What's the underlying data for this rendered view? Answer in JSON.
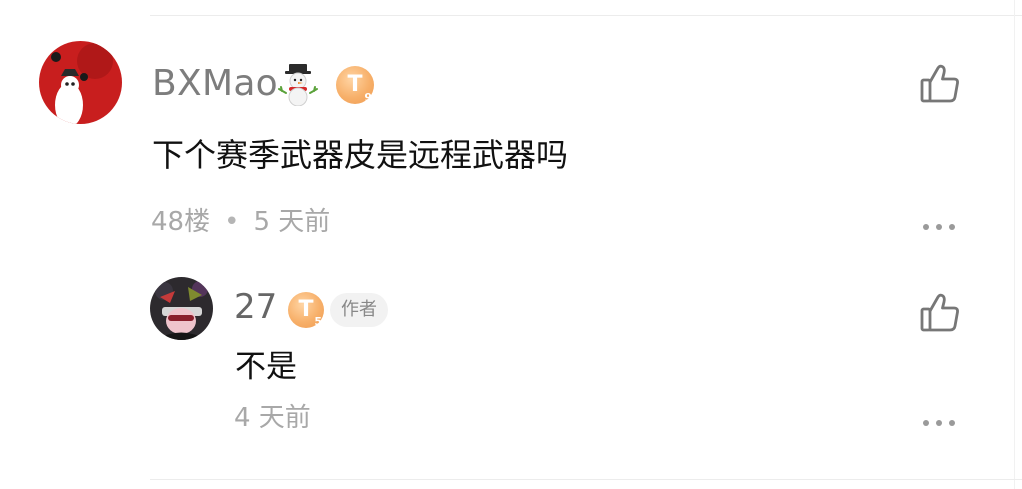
{
  "comments": [
    {
      "username": "BXMao",
      "username_emoji": "snowman-icon",
      "level_badge": {
        "letter": "T",
        "level": "9",
        "color": "#f7b06a"
      },
      "content": "下个赛季武器皮是远程武器吗",
      "floor": "48楼",
      "separator": "•",
      "time": "5 天前"
    },
    {
      "username": "27",
      "level_badge": {
        "letter": "T",
        "level": "5",
        "color": "#f7b06a"
      },
      "author_tag": "作者",
      "content": "不是",
      "time": "4 天前"
    }
  ],
  "colors": {
    "meta_text": "#a8a8a8",
    "username_text": "#7d7d7d",
    "badge_orange": "#f7b06a"
  }
}
